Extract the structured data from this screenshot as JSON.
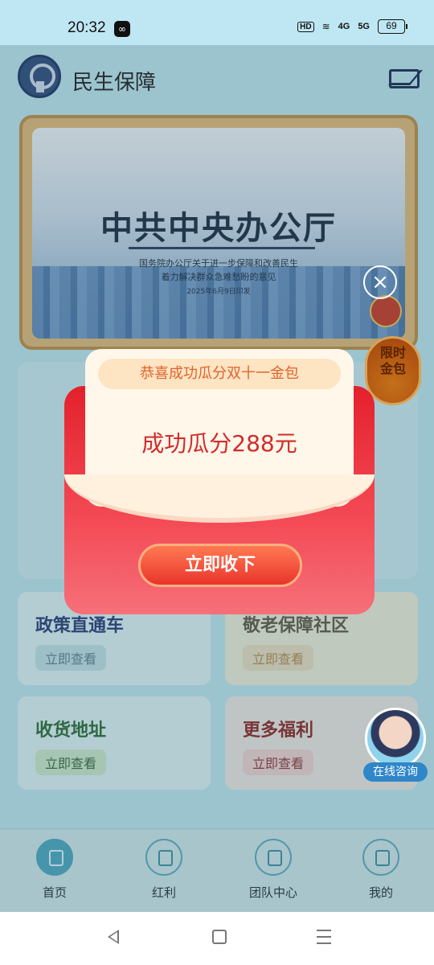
{
  "status_bar": {
    "time": "20:32",
    "network_hd": "HD",
    "signal_4g": "4G",
    "signal_5g": "5G",
    "battery": "69"
  },
  "header": {
    "app_title": "民生保障"
  },
  "banner": {
    "headline": "中共中央办公厅",
    "subtitle_line1": "国务院办公厅关于进一步保障和改善民生",
    "subtitle_line2": "着力解决群众急难愁盼的意见",
    "date": "2025年6月9日印发"
  },
  "cards": [
    {
      "title": "政策直通车",
      "button": "立即查看"
    },
    {
      "title": "敬老保障社区",
      "button": "立即查看"
    },
    {
      "title": "收货地址",
      "button": "立即查看"
    },
    {
      "title": "更多福利",
      "button": "立即查看"
    }
  ],
  "gold_badge": {
    "line1": "限时",
    "line2": "金包"
  },
  "consult": {
    "label": "在线咨询"
  },
  "bottom_nav": [
    {
      "label": "首页",
      "active": true
    },
    {
      "label": "红利",
      "active": false
    },
    {
      "label": "团队中心",
      "active": false
    },
    {
      "label": "我的",
      "active": false
    }
  ],
  "modal": {
    "header": "恭喜成功瓜分双十一金包",
    "amount_text": "成功瓜分288元",
    "accept_button": "立即收下",
    "close_symbol": "×"
  },
  "colors": {
    "packet_red": "#e3212c",
    "accent_orange": "#e0632d",
    "amount_red": "#d22b2b",
    "nav_active": "#4aa6bf"
  }
}
